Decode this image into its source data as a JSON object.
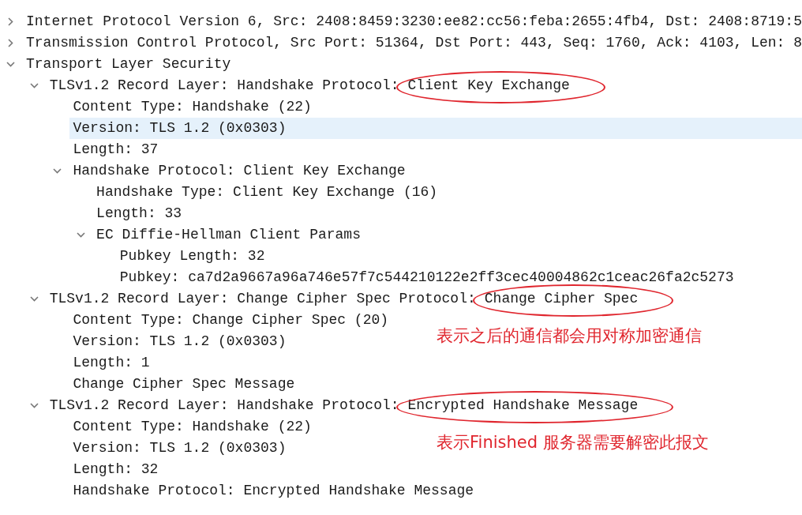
{
  "tree": [
    {
      "text": "Internet Protocol Version 6, Src: 2408:8459:3230:ee82:cc56:feba:2655:4fb4, Dst: 2408:8719:5",
      "expanded": false,
      "selected": false
    },
    {
      "text": "Transmission Control Protocol, Src Port: 51364, Dst Port: 443, Seq: 1760, Ack: 4103, Len: 8",
      "expanded": false,
      "selected": false
    },
    {
      "text": "Transport Layer Security",
      "expanded": true,
      "selected": false,
      "children": [
        {
          "text": "TLSv1.2 Record Layer: Handshake Protocol:",
          "circled_text": "Client Key Exchange",
          "expanded": true,
          "selected": false,
          "children": [
            {
              "text": "Content Type: Handshake (22)",
              "selected": false
            },
            {
              "text": "Version: TLS 1.2 (0x0303)",
              "selected": true
            },
            {
              "text": "Length: 37",
              "selected": false
            },
            {
              "text": "Handshake Protocol: Client Key Exchange",
              "expanded": true,
              "selected": false,
              "children": [
                {
                  "text": "Handshake Type: Client Key Exchange (16)",
                  "selected": false
                },
                {
                  "text": "Length: 33",
                  "selected": false
                },
                {
                  "text": "EC Diffie-Hellman Client Params",
                  "expanded": true,
                  "selected": false,
                  "children": [
                    {
                      "text": "Pubkey Length: 32",
                      "selected": false
                    },
                    {
                      "text": "Pubkey: ca7d2a9667a96a746e57f7c544210122e2ff3cec40004862c1ceac26fa2c5273",
                      "selected": false
                    }
                  ]
                }
              ]
            }
          ]
        },
        {
          "text": "TLSv1.2 Record Layer: Change Cipher Spec Protocol:",
          "circled_text": "Change Cipher Spec",
          "expanded": true,
          "selected": false,
          "children": [
            {
              "text": "Content Type: Change Cipher Spec (20)",
              "selected": false,
              "note": "表示之后的通信都会用对称加密通信"
            },
            {
              "text": "Version: TLS 1.2 (0x0303)",
              "selected": false
            },
            {
              "text": "Length: 1",
              "selected": false
            },
            {
              "text": "Change Cipher Spec Message",
              "selected": false
            }
          ]
        },
        {
          "text": "TLSv1.2 Record Layer: Handshake Protocol:",
          "circled_text": "Encrypted Handshake Message",
          "expanded": true,
          "selected": false,
          "children": [
            {
              "text": "Content Type: Handshake (22)",
              "selected": false,
              "note": "表示Finished 服务器需要解密此报文"
            },
            {
              "text": "Version: TLS 1.2 (0x0303)",
              "selected": false
            },
            {
              "text": "Length: 32",
              "selected": false
            },
            {
              "text": "Handshake Protocol: Encrypted Handshake Message",
              "selected": false
            }
          ]
        }
      ]
    }
  ]
}
